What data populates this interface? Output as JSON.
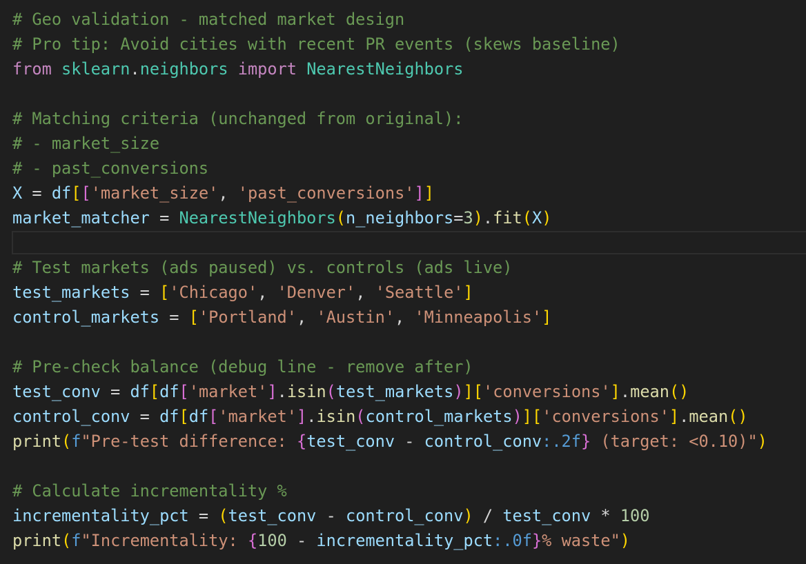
{
  "colors": {
    "background": "#1f1f1f",
    "comment": "#6a9955",
    "keyword": "#c586c0",
    "variable": "#9cdcfe",
    "class": "#4ec9b0",
    "function": "#dcdcaa",
    "string": "#ce9178",
    "number": "#b5cea8",
    "operator": "#d4d4d4",
    "bracket_level_1": "#ffd700",
    "bracket_level_2": "#da70d6",
    "bracket_level_3": "#179fff",
    "format_spec": "#569cd6"
  },
  "editor": {
    "current_line_index": 9,
    "lines": [
      [
        [
          "comment",
          "# Geo validation - matched market design"
        ]
      ],
      [
        [
          "comment",
          "# Pro tip: Avoid cities with recent PR events (skews baseline)"
        ]
      ],
      [
        [
          "keyword",
          "from"
        ],
        [
          "operator",
          " "
        ],
        [
          "class",
          "sklearn"
        ],
        [
          "operator",
          "."
        ],
        [
          "class",
          "neighbors"
        ],
        [
          "operator",
          " "
        ],
        [
          "keyword",
          "import"
        ],
        [
          "operator",
          " "
        ],
        [
          "class",
          "NearestNeighbors"
        ]
      ],
      [],
      [
        [
          "comment",
          "# Matching criteria (unchanged from original):"
        ]
      ],
      [
        [
          "comment",
          "# - market_size"
        ]
      ],
      [
        [
          "comment",
          "# - past_conversions"
        ]
      ],
      [
        [
          "variable",
          "X"
        ],
        [
          "operator",
          " = "
        ],
        [
          "variable",
          "df"
        ],
        [
          "bracket1",
          "["
        ],
        [
          "bracket2",
          "["
        ],
        [
          "string",
          "'market_size'"
        ],
        [
          "operator",
          ", "
        ],
        [
          "string",
          "'past_conversions'"
        ],
        [
          "bracket2",
          "]"
        ],
        [
          "bracket1",
          "]"
        ]
      ],
      [
        [
          "variable",
          "market_matcher"
        ],
        [
          "operator",
          " = "
        ],
        [
          "class",
          "NearestNeighbors"
        ],
        [
          "bracket1",
          "("
        ],
        [
          "variable",
          "n_neighbors"
        ],
        [
          "operator",
          "="
        ],
        [
          "number",
          "3"
        ],
        [
          "bracket1",
          ")"
        ],
        [
          "operator",
          "."
        ],
        [
          "function",
          "fit"
        ],
        [
          "bracket1",
          "("
        ],
        [
          "variable",
          "X"
        ],
        [
          "bracket1",
          ")"
        ]
      ],
      [],
      [
        [
          "comment",
          "# Test markets (ads paused) vs. controls (ads live)"
        ]
      ],
      [
        [
          "variable",
          "test_markets"
        ],
        [
          "operator",
          " = "
        ],
        [
          "bracket1",
          "["
        ],
        [
          "string",
          "'Chicago'"
        ],
        [
          "operator",
          ", "
        ],
        [
          "string",
          "'Denver'"
        ],
        [
          "operator",
          ", "
        ],
        [
          "string",
          "'Seattle'"
        ],
        [
          "bracket1",
          "]"
        ]
      ],
      [
        [
          "variable",
          "control_markets"
        ],
        [
          "operator",
          " = "
        ],
        [
          "bracket1",
          "["
        ],
        [
          "string",
          "'Portland'"
        ],
        [
          "operator",
          ", "
        ],
        [
          "string",
          "'Austin'"
        ],
        [
          "operator",
          ", "
        ],
        [
          "string",
          "'Minneapolis'"
        ],
        [
          "bracket1",
          "]"
        ]
      ],
      [],
      [
        [
          "comment",
          "# Pre-check balance (debug line - remove after)"
        ]
      ],
      [
        [
          "variable",
          "test_conv"
        ],
        [
          "operator",
          " = "
        ],
        [
          "variable",
          "df"
        ],
        [
          "bracket1",
          "["
        ],
        [
          "variable",
          "df"
        ],
        [
          "bracket2",
          "["
        ],
        [
          "string",
          "'market'"
        ],
        [
          "bracket2",
          "]"
        ],
        [
          "operator",
          "."
        ],
        [
          "function",
          "isin"
        ],
        [
          "bracket2",
          "("
        ],
        [
          "variable",
          "test_markets"
        ],
        [
          "bracket2",
          ")"
        ],
        [
          "bracket1",
          "]"
        ],
        [
          "bracket1",
          "["
        ],
        [
          "string",
          "'conversions'"
        ],
        [
          "bracket1",
          "]"
        ],
        [
          "operator",
          "."
        ],
        [
          "function",
          "mean"
        ],
        [
          "bracket1",
          "()"
        ]
      ],
      [
        [
          "variable",
          "control_conv"
        ],
        [
          "operator",
          " = "
        ],
        [
          "variable",
          "df"
        ],
        [
          "bracket1",
          "["
        ],
        [
          "variable",
          "df"
        ],
        [
          "bracket2",
          "["
        ],
        [
          "string",
          "'market'"
        ],
        [
          "bracket2",
          "]"
        ],
        [
          "operator",
          "."
        ],
        [
          "function",
          "isin"
        ],
        [
          "bracket2",
          "("
        ],
        [
          "variable",
          "control_markets"
        ],
        [
          "bracket2",
          ")"
        ],
        [
          "bracket1",
          "]"
        ],
        [
          "bracket1",
          "["
        ],
        [
          "string",
          "'conversions'"
        ],
        [
          "bracket1",
          "]"
        ],
        [
          "operator",
          "."
        ],
        [
          "function",
          "mean"
        ],
        [
          "bracket1",
          "()"
        ]
      ],
      [
        [
          "function",
          "print"
        ],
        [
          "bracket1",
          "("
        ],
        [
          "escape",
          "f"
        ],
        [
          "string",
          "\"Pre-test difference: "
        ],
        [
          "bracket2",
          "{"
        ],
        [
          "variable",
          "test_conv"
        ],
        [
          "operator",
          " - "
        ],
        [
          "variable",
          "control_conv"
        ],
        [
          "escape",
          ":.2f"
        ],
        [
          "bracket2",
          "}"
        ],
        [
          "string",
          " (target: <0.10)\""
        ],
        [
          "bracket1",
          ")"
        ]
      ],
      [],
      [
        [
          "comment",
          "# Calculate incrementality %"
        ]
      ],
      [
        [
          "variable",
          "incrementality_pct"
        ],
        [
          "operator",
          " = "
        ],
        [
          "bracket1",
          "("
        ],
        [
          "variable",
          "test_conv"
        ],
        [
          "operator",
          " - "
        ],
        [
          "variable",
          "control_conv"
        ],
        [
          "bracket1",
          ")"
        ],
        [
          "operator",
          " / "
        ],
        [
          "variable",
          "test_conv"
        ],
        [
          "operator",
          " * "
        ],
        [
          "number",
          "100"
        ]
      ],
      [
        [
          "function",
          "print"
        ],
        [
          "bracket1",
          "("
        ],
        [
          "escape",
          "f"
        ],
        [
          "string",
          "\"Incrementality: "
        ],
        [
          "bracket2",
          "{"
        ],
        [
          "number",
          "100"
        ],
        [
          "operator",
          " - "
        ],
        [
          "variable",
          "incrementality_pct"
        ],
        [
          "escape",
          ":.0f"
        ],
        [
          "bracket2",
          "}"
        ],
        [
          "string",
          "% waste\""
        ],
        [
          "bracket1",
          ")"
        ]
      ]
    ]
  }
}
